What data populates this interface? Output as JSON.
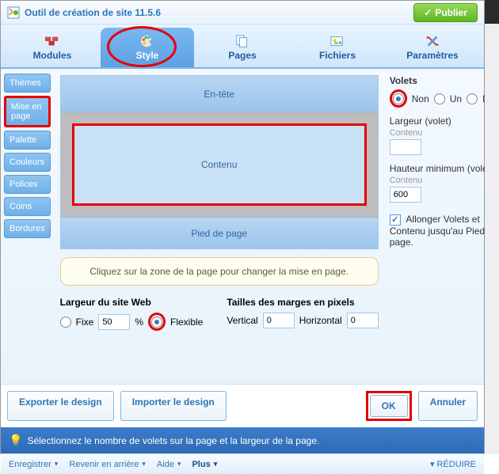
{
  "window": {
    "title": "Outil de création de site 11.5.6"
  },
  "publish": {
    "label": "Publier"
  },
  "tabs": {
    "modules": "Modules",
    "style": "Style",
    "pages": "Pages",
    "fichiers": "Fichiers",
    "parametres": "Paramètres"
  },
  "sidebar": {
    "themes": "Thèmes",
    "mise_en_page": "Mise en page",
    "palette": "Palette",
    "couleurs": "Couleurs",
    "polices": "Polices",
    "coins": "Coins",
    "bordures": "Bordures"
  },
  "layout": {
    "header": "En-tête",
    "content": "Contenu",
    "footer": "Pied de page"
  },
  "tip": "Cliquez sur la zone de la page pour changer la mise en page.",
  "volets": {
    "title": "Volets",
    "non": "Non",
    "un": "Un",
    "deux": "Deux",
    "largeur_label": "Largeur (volet)",
    "largeur_sub": "Contenu",
    "largeur_value": "",
    "hauteur_label": "Hauteur minimum (volet)",
    "hauteur_sub": "Contenu",
    "hauteur_value": "600",
    "allonger": "Allonger Volets et Contenu jusqu'au Pied de page."
  },
  "site_width": {
    "title": "Largeur du site Web",
    "fixe": "Fixe",
    "value": "50",
    "percent": "%",
    "flexible": "Flexible"
  },
  "margins": {
    "title": "Tailles des marges en pixels",
    "vertical_label": "Vertical",
    "vertical_value": "0",
    "horizontal_label": "Horizontal",
    "horizontal_value": "0"
  },
  "buttons": {
    "export": "Exporter le design",
    "import": "Importer le design",
    "ok": "OK",
    "cancel": "Annuler"
  },
  "banner": "Sélectionnez le nombre de volets sur la page et la largeur de la page.",
  "bottom": {
    "save": "Enregistrer",
    "undo": "Revenir en arrière",
    "help": "Aide",
    "plus": "Plus",
    "reduce": "RÉDUIRE"
  }
}
